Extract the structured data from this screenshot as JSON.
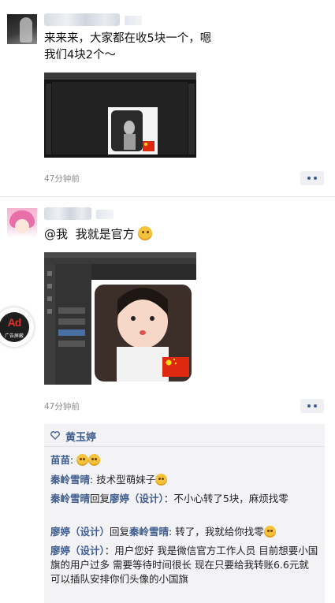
{
  "posts": [
    {
      "text_line1": "来来来，大家都在收5块一个，嗯",
      "text_line2": "我们4块2个～",
      "time": "47分钟前"
    },
    {
      "mention": "@我",
      "text": "我就是官方",
      "time": "47分钟前",
      "likes": {
        "names": "黄玉婷"
      },
      "comments": [
        {
          "author": "苗苗",
          "sep": ": "
        },
        {
          "author": "秦岭雪晴",
          "sep": ": ",
          "text": "技术型萌妹子"
        },
        {
          "author": "秦岭雪晴",
          "reply_word": "回复",
          "target": "廖婷（设计）",
          "sep": "：",
          "text": "不小心转了5块，麻烦找零"
        },
        {
          "author": "廖婷（设计）",
          "reply_word": "回复",
          "target": "秦岭雪晴",
          "sep": ": ",
          "text": "转了，我就给你找零"
        },
        {
          "author": "廖婷（设计）",
          "sep": "：",
          "text": "用户您好 我是微信官方工作人员 目前想要小国旗的用户过多 需要等待时间很长 现在只要给我转账6.6元就可以插队安排你们头像的小国旗"
        }
      ]
    }
  ],
  "ad_badge": {
    "label": "Ad",
    "sublabel": "广告屏蔽"
  },
  "colors": {
    "nickname": "#3f5d8f",
    "flag_red": "#de2910",
    "flag_yellow": "#ffde00"
  }
}
